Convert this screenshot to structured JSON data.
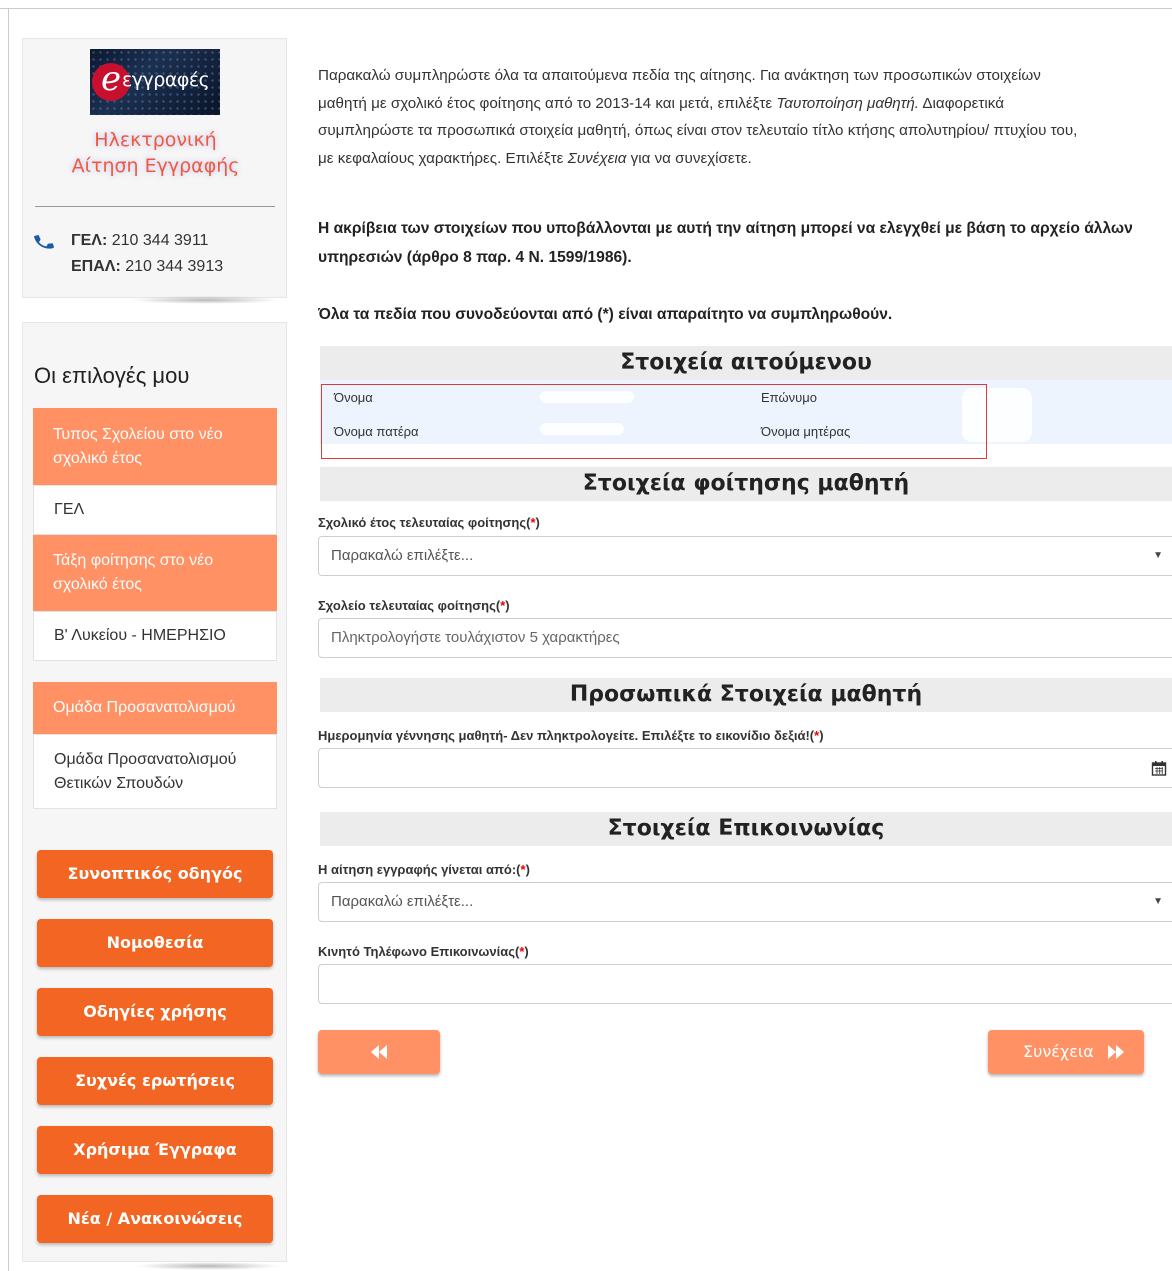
{
  "brand": {
    "logo_text": "εγγραφές",
    "subtitle_line1": "Ηλεκτρονική",
    "subtitle_line2": "Αίτηση Εγγραφής",
    "phone_gel_label": "ΓΕΛ:",
    "phone_gel": "210 344 3911",
    "phone_epal_label": "ΕΠΑΛ:",
    "phone_epal": "210 344 3913"
  },
  "sidebar": {
    "title": "Οι επιλογές μου",
    "options": [
      {
        "label": "Τυπος Σχολείου στο νέο σχολικό έτος",
        "value": "ΓΕΛ"
      },
      {
        "label": "Τάξη φοίτησης στο νέο σχολικό έτος",
        "value": "Β' Λυκείου - ΗΜΕΡΗΣΙΟ"
      },
      {
        "label": "Ομάδα Προσανατολισμού",
        "value": "Ομάδα Προσανατολισμού Θετικών Σπουδών"
      }
    ],
    "buttons": [
      "Συνοπτικός οδηγός",
      "Νομοθεσία",
      "Οδηγίες χρήσης",
      "Συχνές ερωτήσεις",
      "Χρήσιμα Έγγραφα",
      "Νέα / Ανακοινώσεις"
    ]
  },
  "intro": {
    "line1": "Παρακαλώ συμπληρώστε όλα τα απαιτούμενα πεδία της αίτησης. Για ανάκτηση των προσωπικών στοιχείων",
    "line2_a": "μαθητή με σχολικό έτος φοίτησης από το 2013-14 και μετά, επιλέξτε ",
    "line2_em": "Ταυτοποίηση μαθητή.",
    "line2_b": " Διαφορετικά",
    "line3": "συμπληρώστε τα προσωπικά στοιχεία μαθητή, όπως είναι στον τελευταίο τίτλο κτήσης απολυτηρίου/ πτυχίου του,",
    "line4_a": "με κεφαλαίους χαρακτήρες. Επιλέξτε ",
    "line4_em": "Συνέχεια",
    "line4_b": " για να συνεχίσετε.",
    "warning_line1": "Η ακρίβεια των στοιχείων που υποβάλλονται με αυτή την αίτηση μπορεί να ελεγχθεί με βάση το αρχείο άλλων",
    "warning_line2": "υπηρεσιών (άρθρο 8 παρ. 4 Ν. 1599/1986).",
    "required_note": "Όλα τα πεδία που συνοδεύονται από (*) είναι απαραίτητο να συμπληρωθούν."
  },
  "sections": {
    "applicant": "Στοιχεία αιτούμενου",
    "attendance": "Στοιχεία φοίτησης μαθητή",
    "personal": "Προσωπικά Στοιχεία μαθητή",
    "contact": "Στοιχεία Επικοινωνίας"
  },
  "applicant": {
    "first_name_label": "Όνομα",
    "last_name_label": "Επώνυμο",
    "father_label": "Όνομα πατέρα",
    "mother_label": "Όνομα μητέρας"
  },
  "fields": {
    "last_year_label": "Σχολικό έτος τελευταίας φοίτησης(",
    "last_year_value": "Παρακαλώ επιλέξτε...",
    "last_school_label": "Σχολείο τελευταίας φοίτησης(",
    "last_school_placeholder": "Πληκτρολογήστε τουλάχιστον 5 χαρακτήρες",
    "birthdate_label": "Ημερομηνία γέννησης μαθητή- Δεν πληκτρολογείτε. Επιλέξτε το εικονίδιο δεξιά!(",
    "applicant_type_label": "Η αίτηση εγγραφής γίνεται από:(",
    "applicant_type_value": "Παρακαλώ επιλέξτε...",
    "mobile_label": "Κινητό Τηλέφωνο Επικοινωνίας(",
    "req_star": "*",
    "req_close": ")"
  },
  "nav": {
    "next_label": "Συνέχεια"
  },
  "colors": {
    "accent": "#f26522",
    "accent_light": "#ff9165",
    "required": "#e00000"
  }
}
